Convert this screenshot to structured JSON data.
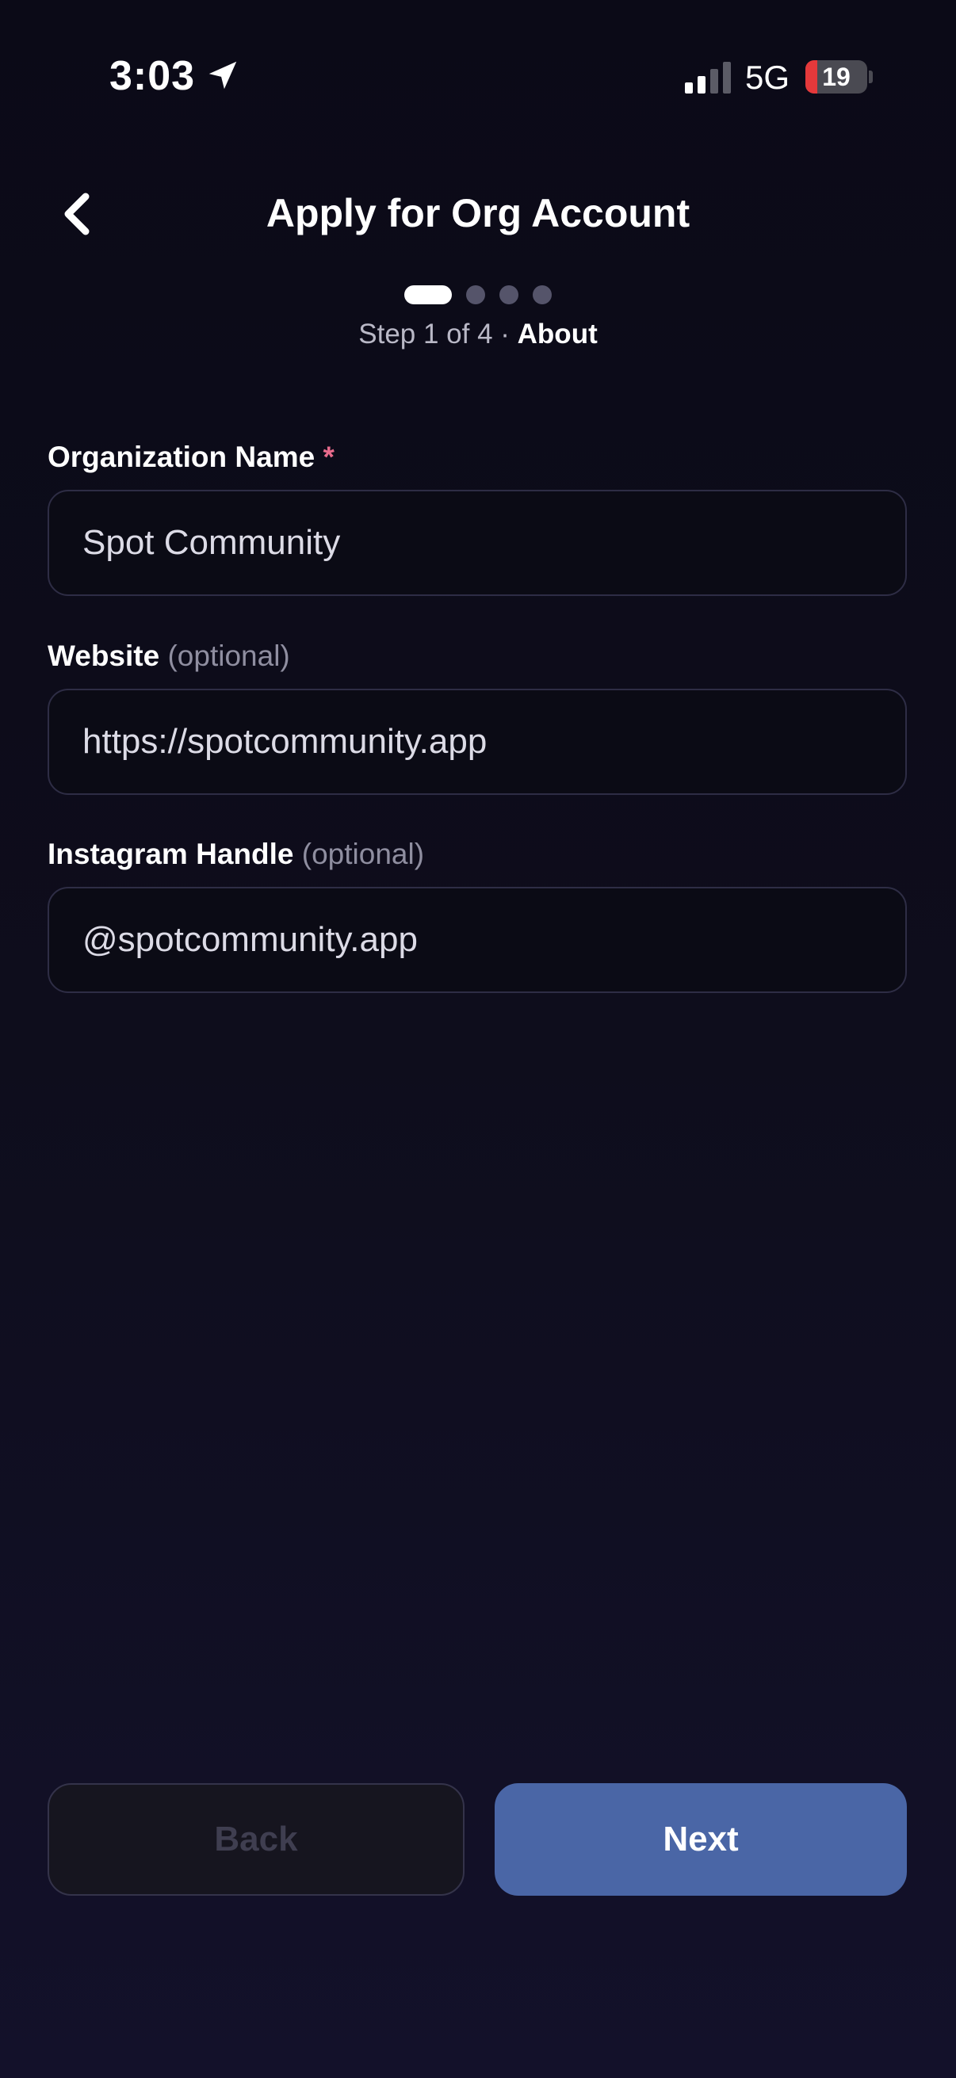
{
  "status_bar": {
    "time": "3:03",
    "network": "5G",
    "battery_level": "19",
    "battery_fraction": 0.19,
    "icons": [
      "location-arrow-icon",
      "cellular-signal-icon",
      "battery-icon"
    ]
  },
  "header": {
    "title": "Apply for Org Account",
    "back_icon": "chevron-left-icon"
  },
  "steps": {
    "total": 4,
    "current": 1,
    "progress_text": "Step 1 of 4 · ",
    "current_name": "About"
  },
  "form": {
    "org_name": {
      "label": "Organization Name",
      "required_mark": "*",
      "value": "Spot Community"
    },
    "website": {
      "label": "Website",
      "optional_text": "(optional)",
      "value": "https://spotcommunity.app"
    },
    "instagram": {
      "label": "Instagram Handle",
      "optional_text": "(optional)",
      "value": "@spotcommunity.app"
    }
  },
  "actions": {
    "back_label": "Back",
    "next_label": "Next"
  },
  "colors": {
    "background": "#0b0a17",
    "accent": "#4a66a6",
    "required": "#e86b8c",
    "battery_low": "#e5393b"
  }
}
